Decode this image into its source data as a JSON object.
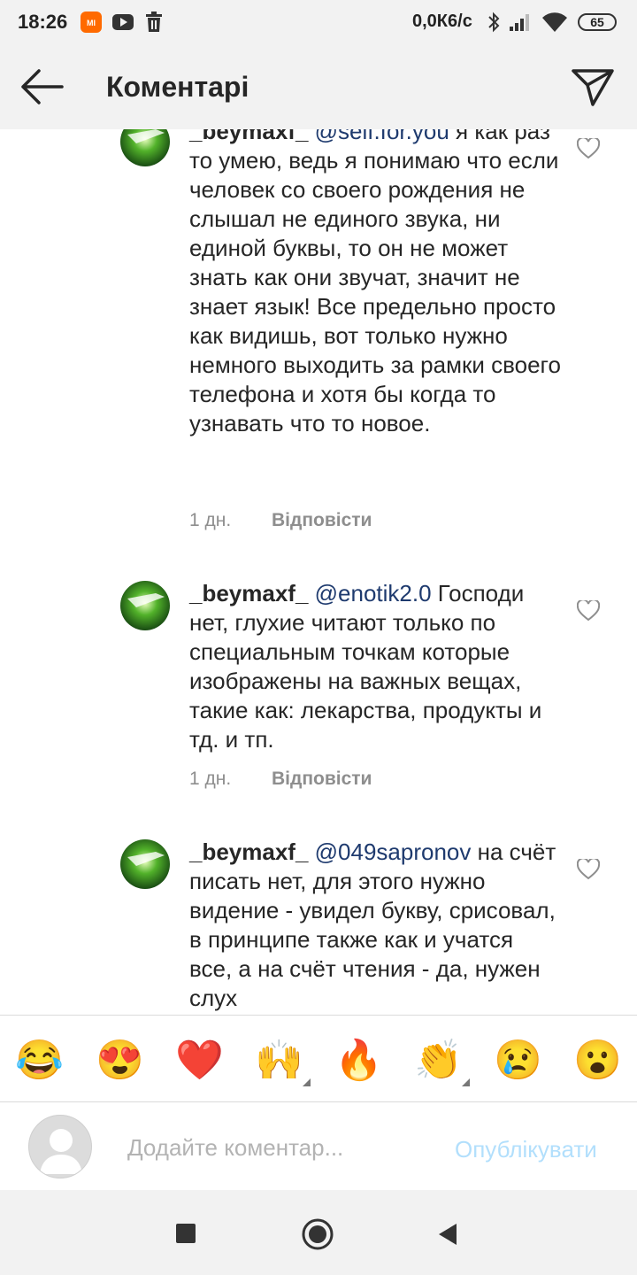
{
  "status_bar": {
    "time": "18:26",
    "network_speed": "0,0К6/c",
    "battery": "65",
    "icons": [
      "mi-icon",
      "youtube-icon",
      "trash-icon",
      "bluetooth-icon",
      "signal-icon",
      "wifi-icon",
      "battery-icon"
    ]
  },
  "header": {
    "title": "Коментарі",
    "back_icon": "arrow-left-icon",
    "send_icon": "paper-plane-icon"
  },
  "comments": [
    {
      "username": "_beymaxf_",
      "mention": "@self.for.you",
      "text": " я как раз то умею,  ведь я понимаю что если человек со своего рождения не слышал не единого звука, ни единой буквы, то он не может знать как они звучат, значит не знает язык! Все предельно просто как видишь, вот только нужно немного выходить за рамки своего телефона и хотя бы когда то узнавать что то новое.",
      "time": "1 дн.",
      "reply_label": "Відповісти"
    },
    {
      "username": "_beymaxf_",
      "mention": "@enotik2.0",
      "text": " Господи нет, глухие читают только по специальным точкам которые изображены на важных вещах, такие как: лекарства, продукты и тд. и тп.",
      "time": "1 дн.",
      "reply_label": "Відповісти"
    },
    {
      "username": "_beymaxf_",
      "mention": "@049sapronov",
      "text": " на счёт писать нет, для этого нужно видение - увидел букву, срисовал, в принципе также как и учатся все, а на счёт чтения - да, нужен слух"
    }
  ],
  "emoji_bar": {
    "emojis": [
      "😂",
      "😍",
      "❤️",
      "🙌",
      "🔥",
      "👏",
      "😢",
      "😮"
    ]
  },
  "comment_input": {
    "placeholder": "Додайте коментар...",
    "value": "",
    "publish_label": "Опублікувати"
  },
  "nav_bar": {
    "icons": [
      "recents-square-icon",
      "home-circle-icon",
      "back-triangle-icon"
    ]
  }
}
